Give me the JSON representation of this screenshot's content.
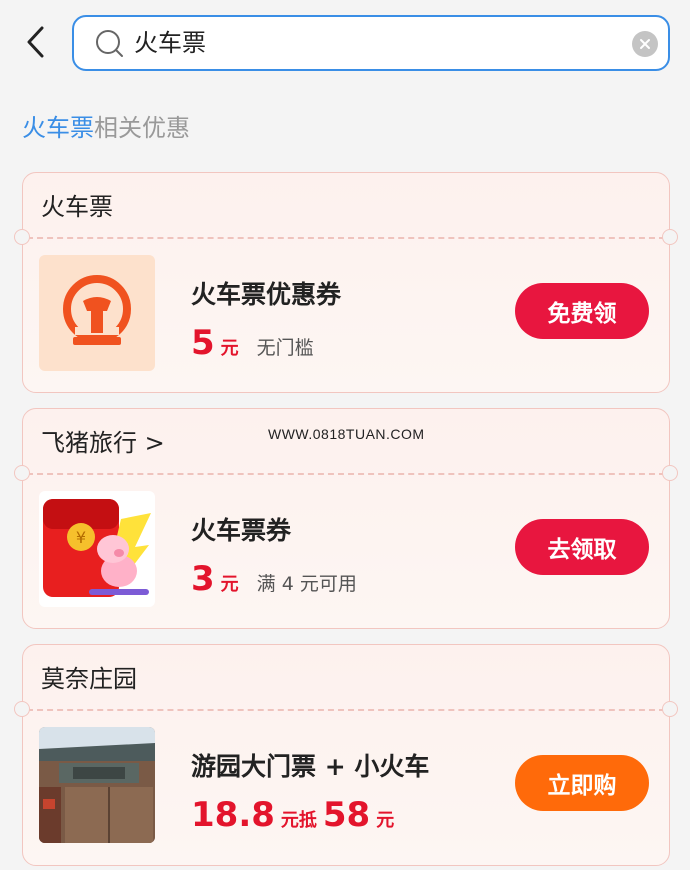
{
  "search": {
    "query": "火车票"
  },
  "section": {
    "title_highlight": "火车票",
    "title_rest": "相关优惠"
  },
  "colors": {
    "accent": "#3a8ee6",
    "price_red": "#e3142c",
    "cta_red": "#e8163f",
    "cta_orange": "#ff6a0a"
  },
  "cards": [
    {
      "header": "火车票",
      "thumb_icon": "railway-logo-icon",
      "title": "火车票优惠券",
      "price": "5",
      "unit": "元",
      "note": "无门槛",
      "cta": "免费领"
    },
    {
      "header": "飞猪旅行 >",
      "thumb_icon": "red-envelope-pig-icon",
      "title": "火车票券",
      "price": "3",
      "unit": "元",
      "note": "满 4 元可用",
      "cta": "去领取"
    },
    {
      "header": "莫奈庄园",
      "thumb_icon": "estate-gate-photo",
      "title": "游园大门票 + 小火车",
      "price": "18.8",
      "unit": "元抵",
      "price2": "58",
      "unit2": "元",
      "cta": "立即购"
    }
  ],
  "watermark": "WWW.0818TUAN.COM"
}
